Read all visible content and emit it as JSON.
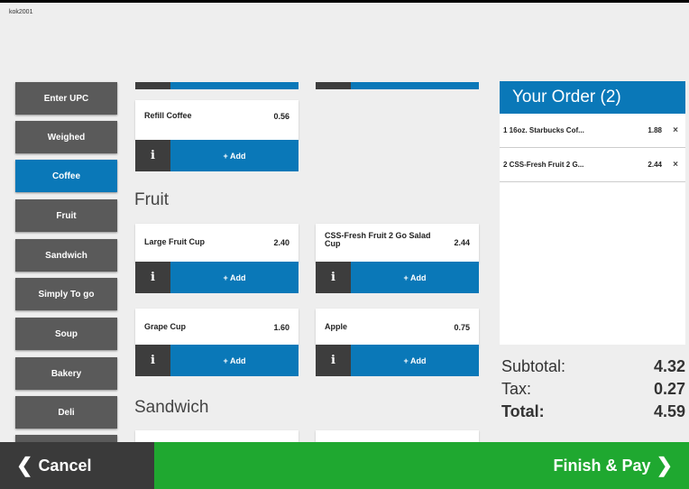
{
  "kiosk_id": "kok2001",
  "categories": [
    {
      "label": "Enter UPC"
    },
    {
      "label": "Weighed"
    },
    {
      "label": "Coffee"
    },
    {
      "label": "Fruit"
    },
    {
      "label": "Sandwich"
    },
    {
      "label": "Simply To go"
    },
    {
      "label": "Soup"
    },
    {
      "label": "Bakery"
    },
    {
      "label": "Deli"
    }
  ],
  "active_category": "Coffee",
  "products": {
    "refill_coffee": {
      "name": "Refill Coffee",
      "price": "0.56"
    },
    "large_fruit_cup": {
      "name": "Large Fruit Cup",
      "price": "2.40"
    },
    "fresh_fruit_salad": {
      "name": "CSS-Fresh Fruit 2 Go Salad Cup",
      "price": "2.44"
    },
    "grape_cup": {
      "name": "Grape Cup",
      "price": "1.60"
    },
    "apple": {
      "name": "Apple",
      "price": "0.75"
    }
  },
  "tile_actions": {
    "info_glyph": "i",
    "add_label": "+ Add"
  },
  "sections": {
    "fruit": "Fruit",
    "sandwich": "Sandwich"
  },
  "order": {
    "title": "Your Order (2)",
    "items": [
      {
        "desc": "1 16oz. Starbucks Cof...",
        "price": "1.88",
        "remove": "×"
      },
      {
        "desc": "2 CSS-Fresh Fruit 2 G...",
        "price": "2.44",
        "remove": "×"
      }
    ],
    "subtotal_label": "Subtotal:",
    "subtotal": "4.32",
    "tax_label": "Tax:",
    "tax": "0.27",
    "total_label": "Total:",
    "total": "4.59"
  },
  "footer": {
    "cancel_label": "Cancel",
    "finish_label": "Finish & Pay"
  },
  "colors": {
    "accent": "#0a78b8",
    "finish": "#1fa830",
    "dark": "#3a3a3a"
  }
}
